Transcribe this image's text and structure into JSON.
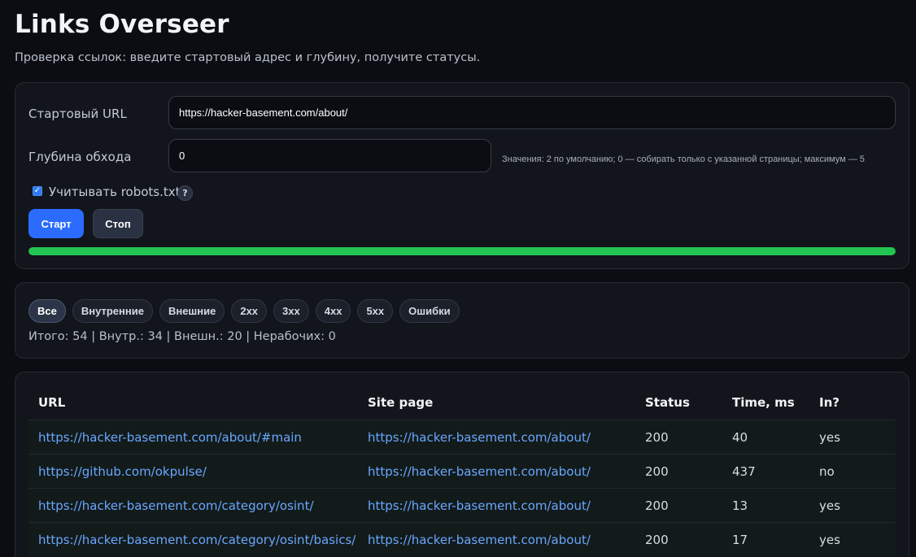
{
  "app": {
    "title": "Links Overseer",
    "subtitle": "Проверка ссылок: введите стартовый адрес и глубину, получите статусы."
  },
  "form": {
    "url_label": "Стартовый URL",
    "url_value": "https://hacker-basement.com/about/",
    "depth_label": "Глубина обхода",
    "depth_value": "0",
    "depth_hint": "Значения: 2 по умолчанию; 0 — собирать только с указанной страницы; максимум — 5",
    "robots_label": "Учитывать robots.txt",
    "robots_checked": true,
    "help_symbol": "?",
    "start_label": "Старт",
    "stop_label": "Стоп",
    "progress_percent": 100,
    "progress_color": "#23c552"
  },
  "filters": {
    "chips": [
      "Все",
      "Внутренние",
      "Внешние",
      "2xx",
      "3xx",
      "4xx",
      "5xx",
      "Ошибки"
    ],
    "active": "Все",
    "summary": "Итого: 54 | Внутр.: 34 | Внешн.: 20 | Нерабочих: 0"
  },
  "table": {
    "columns": [
      "URL",
      "Site page",
      "Status",
      "Time, ms",
      "In?"
    ],
    "rows": [
      {
        "url": "https://hacker-basement.com/about/#main",
        "page": "https://hacker-basement.com/about/",
        "status": "200",
        "time": "40",
        "internal": "yes"
      },
      {
        "url": "https://github.com/okpulse/",
        "page": "https://hacker-basement.com/about/",
        "status": "200",
        "time": "437",
        "internal": "no"
      },
      {
        "url": "https://hacker-basement.com/category/osint/",
        "page": "https://hacker-basement.com/about/",
        "status": "200",
        "time": "13",
        "internal": "yes"
      },
      {
        "url": "https://hacker-basement.com/category/osint/basics/",
        "page": "https://hacker-basement.com/about/",
        "status": "200",
        "time": "17",
        "internal": "yes"
      }
    ]
  },
  "colors": {
    "accent": "#2b6cff",
    "link": "#6aa6ff",
    "background": "#0b0d12",
    "card": "#12151b"
  }
}
